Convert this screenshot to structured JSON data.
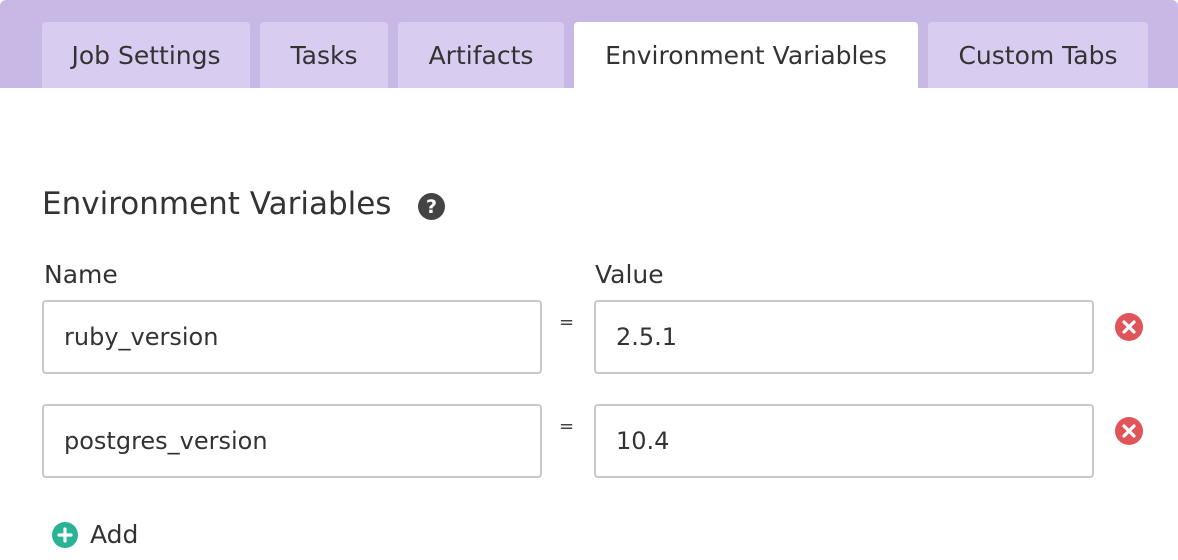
{
  "tabs": [
    {
      "label": "Job Settings",
      "active": false
    },
    {
      "label": "Tasks",
      "active": false
    },
    {
      "label": "Artifacts",
      "active": false
    },
    {
      "label": "Environment Variables",
      "active": true
    },
    {
      "label": "Custom Tabs",
      "active": false
    }
  ],
  "section": {
    "title": "Environment Variables",
    "help_icon": "question-circle-icon"
  },
  "columns": {
    "name": "Name",
    "value": "Value"
  },
  "variables": [
    {
      "name": "ruby_version",
      "value": "2.5.1"
    },
    {
      "name": "postgres_version",
      "value": "10.4"
    }
  ],
  "separator": "=",
  "add": {
    "label": "Add",
    "icon": "plus-circle-icon"
  },
  "colors": {
    "tabbar_bg": "#c8b8e6",
    "tab_bg": "#d8ccf0",
    "tab_active_bg": "#ffffff",
    "remove": "#e0555a",
    "add": "#2bb396"
  }
}
